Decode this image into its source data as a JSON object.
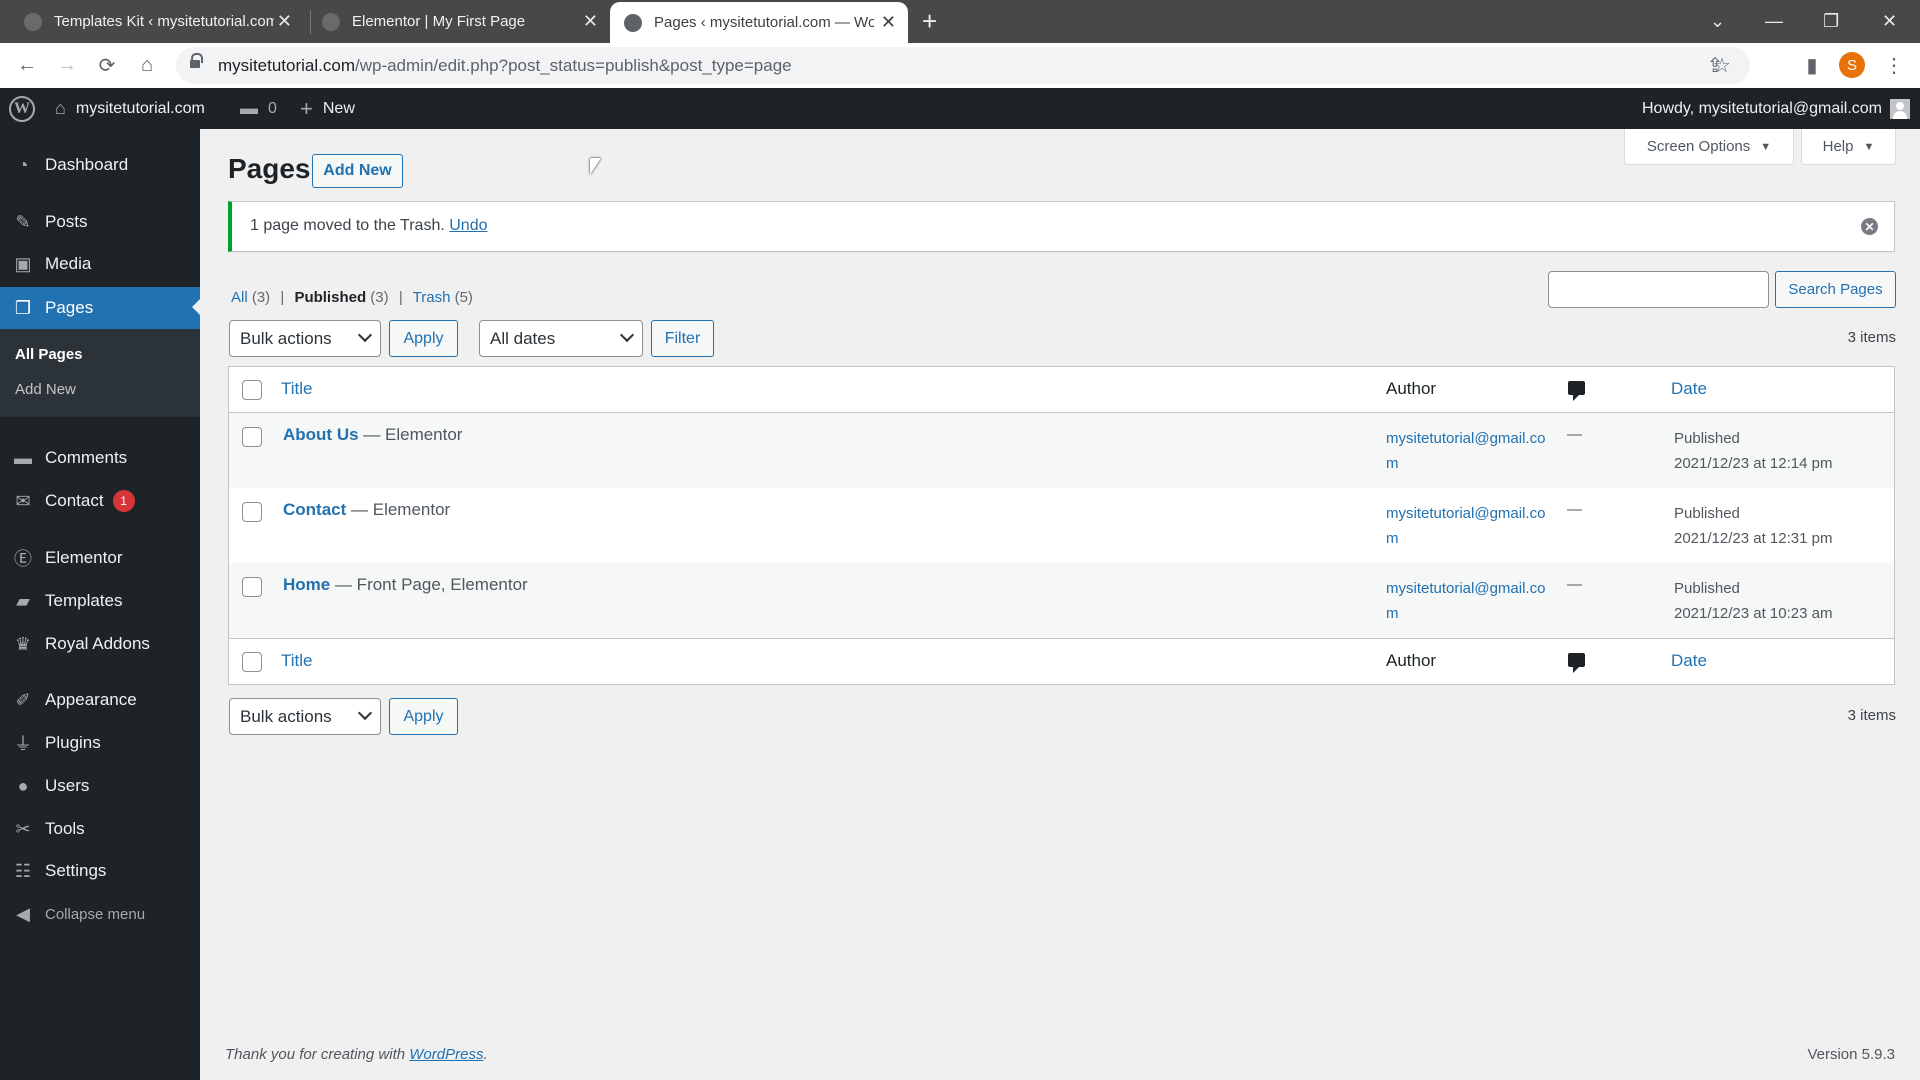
{
  "browser": {
    "tabs": [
      {
        "title": "Templates Kit ‹ mysitetutorial.com",
        "active": false
      },
      {
        "title": "Elementor | My First Page",
        "active": false
      },
      {
        "title": "Pages ‹ mysitetutorial.com — WordPress",
        "active": true
      }
    ],
    "new_tab": "+",
    "url_host": "mysitetutorial.com",
    "url_path": "/wp-admin/edit.php?post_status=publish&post_type=page",
    "profile_initial": "S",
    "icons": {
      "back": "←",
      "forward": "→",
      "reload": "⟳",
      "home": "⌂",
      "share": "⇪",
      "star": "☆",
      "sidepanel": "▮",
      "menu": "⋮",
      "tab_list": "⌄",
      "minimize": "—",
      "restore": "❐",
      "close": "✕"
    }
  },
  "adminbar": {
    "wp_logo": "W",
    "site_name": "mysitetutorial.com",
    "comments_count": "0",
    "new_label": "New",
    "howdy": "Howdy, mysitetutorial@gmail.com"
  },
  "sidebar": {
    "items": [
      {
        "label": "Dashboard",
        "icon": "dashboard-icon",
        "glyph": "◔"
      },
      {
        "label": "Posts",
        "icon": "pin-icon",
        "glyph": "✎"
      },
      {
        "label": "Media",
        "icon": "media-icon",
        "glyph": "▣"
      },
      {
        "label": "Pages",
        "icon": "pages-icon",
        "glyph": "❐",
        "current": true
      },
      {
        "label": "Comments",
        "icon": "comment-icon",
        "glyph": "▬"
      },
      {
        "label": "Contact",
        "icon": "mail-icon",
        "glyph": "✉",
        "badge": "1"
      },
      {
        "label": "Elementor",
        "icon": "elementor-icon",
        "glyph": "Ⓔ"
      },
      {
        "label": "Templates",
        "icon": "folder-icon",
        "glyph": "▰"
      },
      {
        "label": "Royal Addons",
        "icon": "crown-icon",
        "glyph": "♛"
      },
      {
        "label": "Appearance",
        "icon": "brush-icon",
        "glyph": "✐"
      },
      {
        "label": "Plugins",
        "icon": "plug-icon",
        "glyph": "⏚"
      },
      {
        "label": "Users",
        "icon": "user-icon",
        "glyph": "●"
      },
      {
        "label": "Tools",
        "icon": "wrench-icon",
        "glyph": "✂"
      },
      {
        "label": "Settings",
        "icon": "settings-icon",
        "glyph": "☷"
      }
    ],
    "submenu": [
      {
        "label": "All Pages",
        "current": true
      },
      {
        "label": "Add New",
        "current": false
      }
    ],
    "collapse_label": "Collapse menu",
    "collapse_glyph": "◀"
  },
  "header": {
    "screen_options": "Screen Options",
    "help": "Help",
    "dropdown_arrow": "▼",
    "title": "Pages",
    "add_new": "Add New"
  },
  "notice": {
    "message": "1 page moved to the Trash. ",
    "undo": "Undo",
    "dismiss": "✕"
  },
  "filters": {
    "views": [
      {
        "label": "All",
        "count": "(3)"
      },
      {
        "label": "Published",
        "count": "(3)",
        "current": true
      },
      {
        "label": "Trash",
        "count": "(5)"
      }
    ],
    "separator": "|",
    "search_placeholder": "",
    "search_button": "Search Pages",
    "bulk_actions": "Bulk actions",
    "apply": "Apply",
    "all_dates": "All dates",
    "filter": "Filter",
    "items_count": "3 items"
  },
  "table": {
    "columns": {
      "title": "Title",
      "author": "Author",
      "comments": "comments-icon",
      "date": "Date"
    },
    "rows": [
      {
        "title": "About Us",
        "state": " — Elementor",
        "author": "mysitetutorial@gmail.com",
        "comments": "—",
        "status": "Published",
        "date": "2021/12/23 at 12:14 pm"
      },
      {
        "title": "Contact",
        "state": " — Elementor",
        "author": "mysitetutorial@gmail.com",
        "comments": "—",
        "status": "Published",
        "date": "2021/12/23 at 12:31 pm"
      },
      {
        "title": "Home",
        "state": " — Front Page, Elementor",
        "author": "mysitetutorial@gmail.com",
        "comments": "—",
        "status": "Published",
        "date": "2021/12/23 at 10:23 am"
      }
    ]
  },
  "footer": {
    "thanks": "Thank you for creating with ",
    "wordpress": "WordPress",
    "period": ".",
    "version": "Version 5.9.3"
  }
}
